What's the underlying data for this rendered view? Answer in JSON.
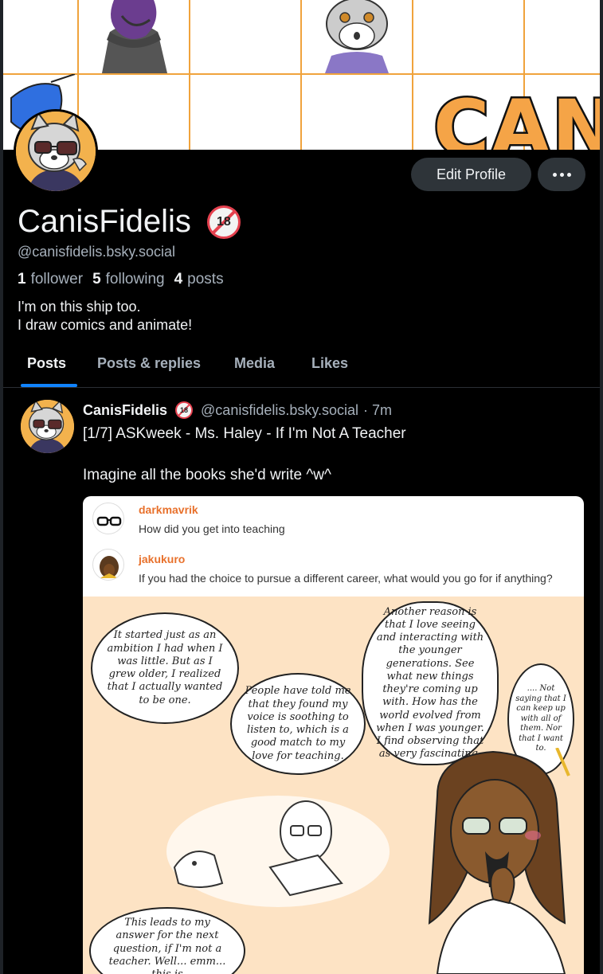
{
  "profile": {
    "display_name": "CanisFidelis",
    "age_badge": "18",
    "handle": "@canisfidelis.bsky.social",
    "stats": {
      "followers_count": "1",
      "followers_label": "follower",
      "following_count": "5",
      "following_label": "following",
      "posts_count": "4",
      "posts_label": "posts"
    },
    "bio_line1": "I'm on this ship too.",
    "bio_line2": "I draw comics and animate!",
    "edit_button": "Edit Profile",
    "banner_text": "CANI"
  },
  "tabs": [
    {
      "label": "Posts",
      "active": true
    },
    {
      "label": "Posts & replies",
      "active": false
    },
    {
      "label": "Media",
      "active": false
    },
    {
      "label": "Likes",
      "active": false
    }
  ],
  "post": {
    "author": "CanisFidelis",
    "badge": "18",
    "handle": "@canisfidelis.bsky.social",
    "time": "· 7m",
    "text": "[1/7] ASKweek - Ms. Haley - If I'm Not A Teacher\n\nImagine all the books she'd write ^w^"
  },
  "comic": {
    "q1_user": "darkmavrik",
    "q1_text": "How did you get into teaching",
    "q2_user": "jakukuro",
    "q2_text": "If you had the choice to pursue a different career, what would you go for if anything?",
    "bubble1": "It started just as an ambition I had when I was little. But as I grew older, I realized that I actually wanted to be one.",
    "bubble2": "People have told me that they found my voice is soothing to listen to, which is a good match to my love for teaching.",
    "bubble3": "Another reason is that I love seeing and interacting with the younger generations. See what new things they're coming up with. How has the world evolved from when I was younger. I find observing that as very fascinating.",
    "bubble4": ".... Not saying that I can keep up with all of them. Nor that I want to.",
    "bubble5": "This leads to my answer for the next question, if I'm not a teacher. Well... emm... this is"
  },
  "colors": {
    "background": "#000000",
    "accent": "#1083fe",
    "muted": "#a6b0bb",
    "button": "#2e3439",
    "banner_grid": "#f0a33c"
  }
}
